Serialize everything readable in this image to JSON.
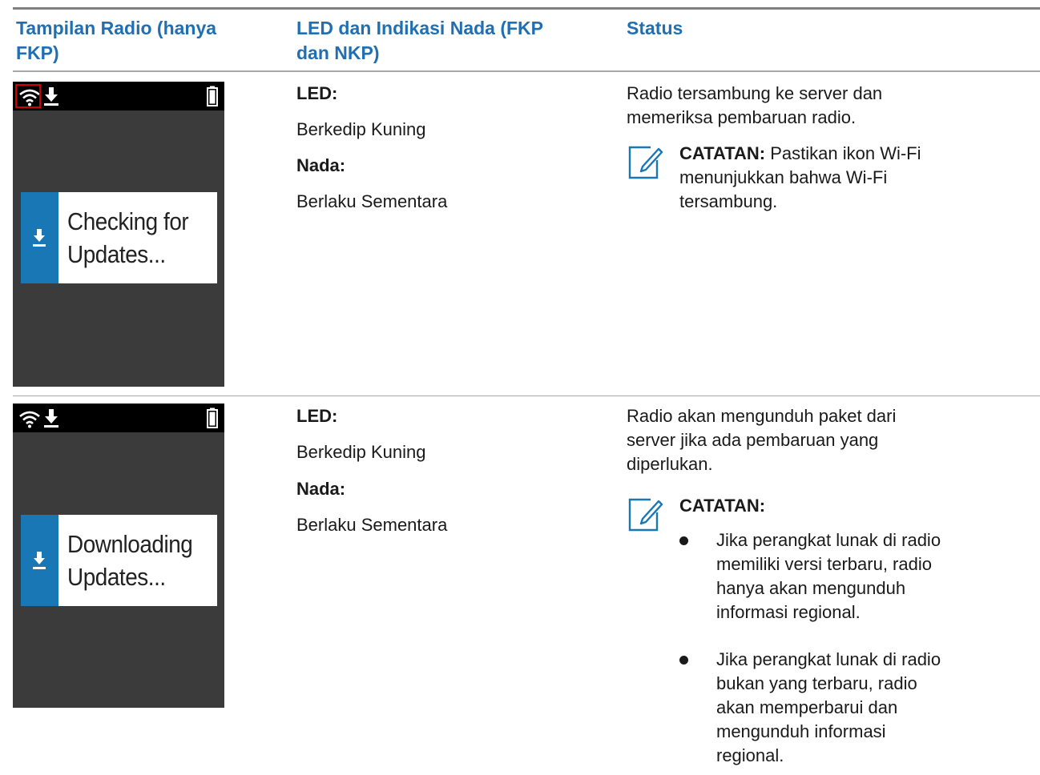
{
  "headers": {
    "col1": "Tampilan Radio (hanya FKP)",
    "col1_line1": "Tampilan Radio (hanya",
    "col1_line2": "FKP)",
    "col2_line1": "LED dan Indikasi Nada (FKP",
    "col2_line2": "dan NKP)",
    "col3": "Status"
  },
  "rows": [
    {
      "screen": {
        "line1": "Checking for",
        "line2": "Updates..."
      },
      "led_label": "LED:",
      "led_value": "Berkedip Kuning",
      "tone_label": "Nada:",
      "tone_value": "Berlaku Sementara",
      "status_line1": "Radio tersambung ke server dan",
      "status_line2": "memeriksa pembaruan radio.",
      "note_label": "CATATAN:",
      "note_line1_rest": " Pastikan ikon Wi-Fi",
      "note_line2": "menunjukkan bahwa Wi-Fi",
      "note_line3": "tersambung."
    },
    {
      "screen": {
        "line1": "Downloading",
        "line2": "Updates..."
      },
      "led_label": "LED:",
      "led_value": "Berkedip Kuning",
      "tone_label": "Nada:",
      "tone_value": "Berlaku Sementara",
      "status_line1": "Radio akan mengunduh paket dari",
      "status_line2": "server jika ada pembaruan yang",
      "status_line3": "diperlukan.",
      "note_label": "CATATAN:",
      "bullets": [
        {
          "lines": [
            "Jika perangkat lunak di radio",
            "memiliki versi terbaru, radio",
            "hanya akan mengunduh",
            "informasi regional."
          ]
        },
        {
          "lines": [
            "Jika perangkat lunak di radio",
            "bukan yang terbaru, radio",
            "akan memperbarui dan",
            "mengunduh informasi",
            "regional."
          ]
        }
      ]
    }
  ],
  "colors": {
    "header_blue": "#1f6fb2",
    "card_strip_blue": "#1a77b5",
    "screen_bg": "#3b3b3b",
    "highlight_red": "#d10000"
  },
  "icons": [
    "wifi-icon",
    "download-icon",
    "battery-icon",
    "note-pencil-icon"
  ]
}
